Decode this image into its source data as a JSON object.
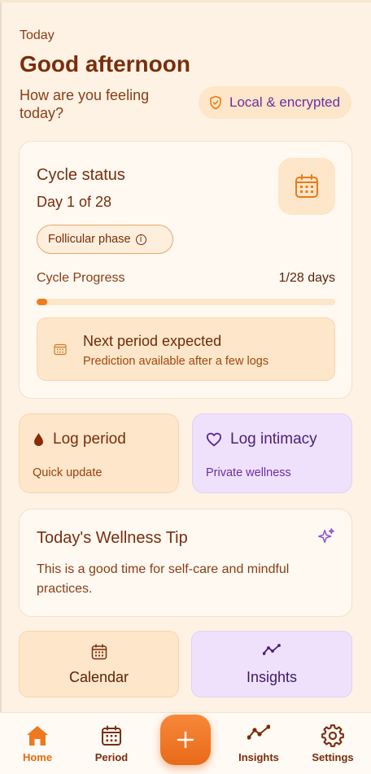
{
  "header": {
    "eyebrow": "Today",
    "greeting": "Good afternoon",
    "subtitle": "How are you feeling today?",
    "privacy_badge": "Local & encrypted"
  },
  "cycle": {
    "title": "Cycle status",
    "day_text": "Day 1 of 28",
    "phase": "Follicular phase",
    "progress_label": "Cycle Progress",
    "progress_value": "1/28 days",
    "progress_fraction": 0.036,
    "next_title": "Next period expected",
    "next_subtitle": "Prediction available after a few logs"
  },
  "actions": {
    "log_period": {
      "title": "Log period",
      "subtitle": "Quick update"
    },
    "log_intimacy": {
      "title": "Log intimacy",
      "subtitle": "Private wellness"
    }
  },
  "tip": {
    "title": "Today's Wellness Tip",
    "body": "This is a good time for self-care and mindful practices."
  },
  "quick_links": {
    "calendar": "Calendar",
    "insights": "Insights"
  },
  "nav": {
    "home": "Home",
    "period": "Period",
    "insights": "Insights",
    "settings": "Settings"
  },
  "colors": {
    "accent": "#f07a1e",
    "background": "#fdf2e4",
    "text_brown": "#7a2d0b",
    "purple": "#6b2fa3"
  },
  "icons": [
    "shield-check-icon",
    "calendar-icon",
    "info-icon",
    "drop-icon",
    "heart-icon",
    "sparkle-icon",
    "trend-icon",
    "home-icon",
    "plus-icon",
    "gear-icon"
  ]
}
